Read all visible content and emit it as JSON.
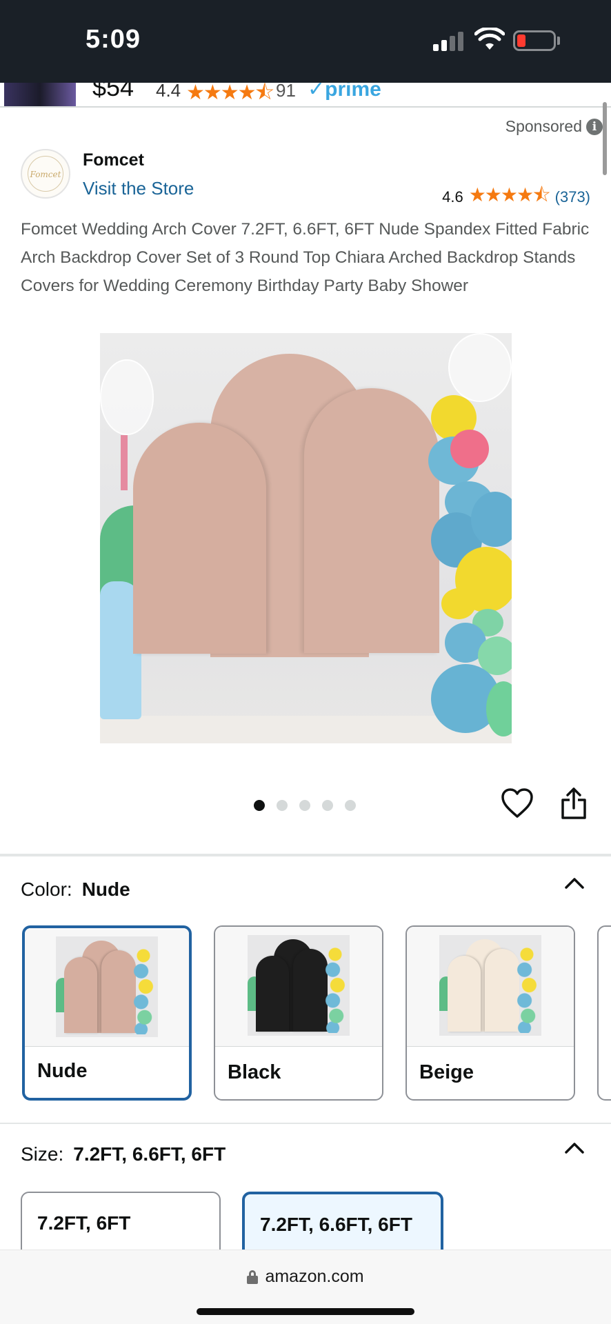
{
  "status_bar": {
    "time": "5:09"
  },
  "previous_result": {
    "price": "$54",
    "rating": "4.4",
    "stars": "★★★★⯪",
    "count": "91",
    "prime": "✓prime"
  },
  "product": {
    "sponsored_label": "Sponsored",
    "info_icon": "i",
    "brand_logo_text": "Fomcet",
    "brand_name": "Fomcet",
    "visit_store": "Visit the Store",
    "rating": "4.6",
    "stars": "★★★★⯪",
    "review_count": "(373)",
    "title": "Fomcet Wedding Arch Cover 7.2FT, 6.6FT, 6FT Nude Spandex Fitted Fabric Arch Backdrop Cover Set of 3 Round Top Chiara Arched Backdrop Stands Covers for Wedding Ceremony Birthday Party Baby Shower",
    "image_count": 5,
    "active_image_index": 0
  },
  "color_section": {
    "label": "Color:",
    "selected_value": "Nude",
    "options": [
      {
        "label": "Nude",
        "color": "#d5ae9f",
        "selected": true
      },
      {
        "label": "Black",
        "color": "#1e1e1e",
        "selected": false
      },
      {
        "label": "Beige",
        "color": "#f4e9db",
        "selected": false
      }
    ]
  },
  "size_section": {
    "label": "Size:",
    "selected_value": "7.2FT, 6.6FT, 6FT",
    "options": [
      {
        "label": "7.2FT, 6FT",
        "selected": false
      },
      {
        "label": "7.2FT, 6.6FT, 6FT",
        "selected": true
      }
    ]
  },
  "browser": {
    "url": "amazon.com"
  },
  "colors": {
    "link_blue": "#1a6497",
    "star_orange": "#f57a11",
    "selected_border": "#2162a1",
    "status_bar_bg": "#1a2027"
  }
}
